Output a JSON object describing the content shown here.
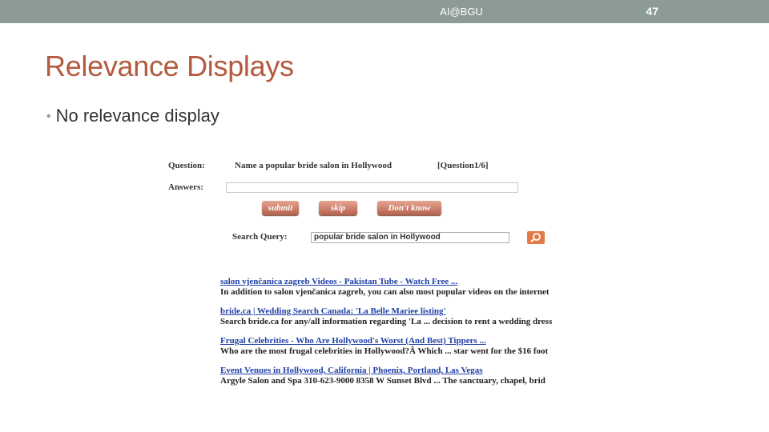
{
  "header": {
    "text": "AI@BGU",
    "page_number": "47"
  },
  "slide": {
    "title": "Relevance Displays",
    "bullet": "No relevance display"
  },
  "screenshot": {
    "question_label": "Question:",
    "question_text": "Name a popular bride salon in Hollywood",
    "question_counter": "[Question1/6]",
    "answers_label": "Answers:",
    "answers_value": "",
    "buttons": {
      "submit": "submit",
      "skip": "skip",
      "dont_know": "Don't know"
    },
    "search_label": "Search Query:",
    "search_value": "popular bride salon in Hollywood",
    "results": [
      {
        "title": "salon vjenčanica zagreb Videos - Pakistan Tube - Watch Free ...",
        "snippet": "In addition to salon vjenčanica zagreb, you can also most popular videos on the internet"
      },
      {
        "title": "bride.ca | Wedding Search Canada: 'La Belle Mariee listing'",
        "snippet": "Search bride.ca for any/all information regarding 'La ... decision to rent a wedding dress"
      },
      {
        "title": "Frugal Celebrities - Who Are Hollywood's Worst (And Best) Tippers ...",
        "snippet": "Who are the most frugal celebrities in Hollywood?Â Which ... star went for the $16 foot"
      },
      {
        "title": "Event Venues in Hollywood, California | Phoenix, Portland, Las Vegas",
        "snippet": "Argyle Salon and Spa 310-623-9000 8358 W Sunset Blvd ... The sanctuary, chapel, brid"
      }
    ]
  }
}
